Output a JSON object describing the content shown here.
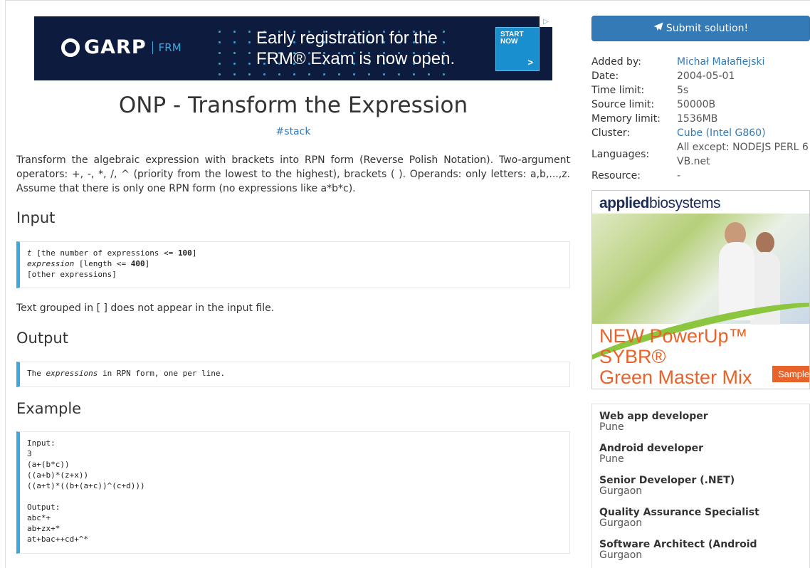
{
  "ad_banner": {
    "logo": "GARP",
    "logo_sub": "FRM",
    "headline_line1": "Early registration for the",
    "headline_line2": "FRM® Exam is now open.",
    "cta_line1": "START",
    "cta_line2": "NOW",
    "cta_arrow": ">",
    "choices_icon": "▷"
  },
  "problem": {
    "title": "ONP - Transform the Expression",
    "tag": "#stack",
    "description": "Transform the algebraic expression with brackets into RPN form (Reverse Polish Notation). Two-argument operators: +, -, *, /, ^ (priority from the lowest to the highest), brackets ( ). Operands: only letters: a,b,...,z. Assume that there is only one RPN form (no expressions like a*b*c).",
    "input_heading": "Input",
    "input_line1_var": "t",
    "input_line1_rest": " [the number of expressions <= ",
    "input_line1_num": "100",
    "input_line1_end": "]",
    "input_line2_var": "expression",
    "input_line2_rest": " [length <= ",
    "input_line2_num": "400",
    "input_line2_end": "]",
    "input_line3": "[other expressions]",
    "input_note": "Text grouped in [ ] does not appear in the input file.",
    "output_heading": "Output",
    "output_pre": "The ",
    "output_var": "expressions",
    "output_post": " in RPN form, one per line.",
    "example_heading": "Example",
    "example_text": "Input:\n3\n(a+(b*c))\n((a+b)*(z+x))\n((a+t)*((b+(a+c))^(c+d)))\n\nOutput:\nabc*+\nab+zx+*\nat+bac++cd+^*"
  },
  "sidebar": {
    "submit_label": "Submit solution!",
    "submit_icon": "paper-plane-icon",
    "info": {
      "added_by_label": "Added by:",
      "added_by_value": "Michał Małafiejski",
      "date_label": "Date:",
      "date_value": "2004-05-01",
      "time_limit_label": "Time limit:",
      "time_limit_value": "5s",
      "source_limit_label": "Source limit:",
      "source_limit_value": "50000B",
      "memory_limit_label": "Memory limit:",
      "memory_limit_value": "1536MB",
      "cluster_label": "Cluster:",
      "cluster_value": "Cube (Intel G860)",
      "languages_label": "Languages:",
      "languages_value": "All except: NODEJS PERL 6 VB.net",
      "resource_label": "Resource:",
      "resource_value": "-"
    },
    "ad2": {
      "brand_bold": "applied",
      "brand_rest": "biosystems",
      "product_line1": "NEW PowerUp™ SYBR®",
      "product_line2": "Green Master Mix",
      "sample_label": "Sample"
    },
    "jobs": [
      {
        "title": "Web app developer",
        "location": "Pune"
      },
      {
        "title": "Android developer",
        "location": "Pune"
      },
      {
        "title": "Senior Developer (.NET)",
        "location": "Gurgaon"
      },
      {
        "title": "Quality Assurance Specialist",
        "location": "Gurgaon"
      },
      {
        "title": "Software Architect (Android",
        "location": "Gurgaon"
      }
    ]
  },
  "colors": {
    "link": "#337ab7",
    "code_accent": "#3ea8dc",
    "ad_background": "#0d1b3e",
    "ad2_orange": "#e8632a"
  }
}
